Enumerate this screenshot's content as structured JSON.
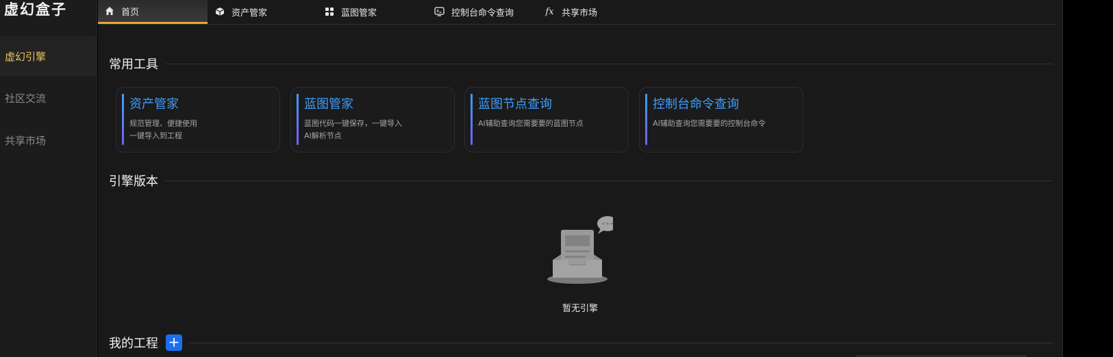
{
  "app": {
    "logo": "虚幻盒子"
  },
  "sidebar": {
    "items": [
      {
        "label": "虚幻引擎"
      },
      {
        "label": "社区交流"
      },
      {
        "label": "共享市场"
      }
    ]
  },
  "topnav": {
    "tabs": [
      {
        "label": "首页",
        "icon": "home-icon"
      },
      {
        "label": "资产管家",
        "icon": "cube-icon"
      },
      {
        "label": "蓝图管家",
        "icon": "grid-icon"
      },
      {
        "label": "控制台命令查询",
        "icon": "console-icon"
      },
      {
        "label": "共享市场",
        "icon": "fx-icon"
      }
    ]
  },
  "sections": {
    "tools_title": "常用工具",
    "engine_title": "引擎版本",
    "projects_title": "我的工程",
    "add_label": "+"
  },
  "tools": [
    {
      "title": "资产管家",
      "desc": "规范管理、便捷使用\n一键导入到工程"
    },
    {
      "title": "蓝图管家",
      "desc": "蓝图代码一键保存，一键导入\nAI解析节点"
    },
    {
      "title": "蓝图节点查询",
      "desc": "AI辅助查询您需要要的蓝图节点"
    },
    {
      "title": "控制台命令查询",
      "desc": "AI辅助查询您需要要的控制台命令"
    }
  ],
  "engine": {
    "empty_text": "暂无引擎"
  },
  "colors": {
    "accent": "#e9a733",
    "link": "#3d9eff",
    "active_side": "#e8c15d",
    "add_button": "#1a6ff0"
  }
}
